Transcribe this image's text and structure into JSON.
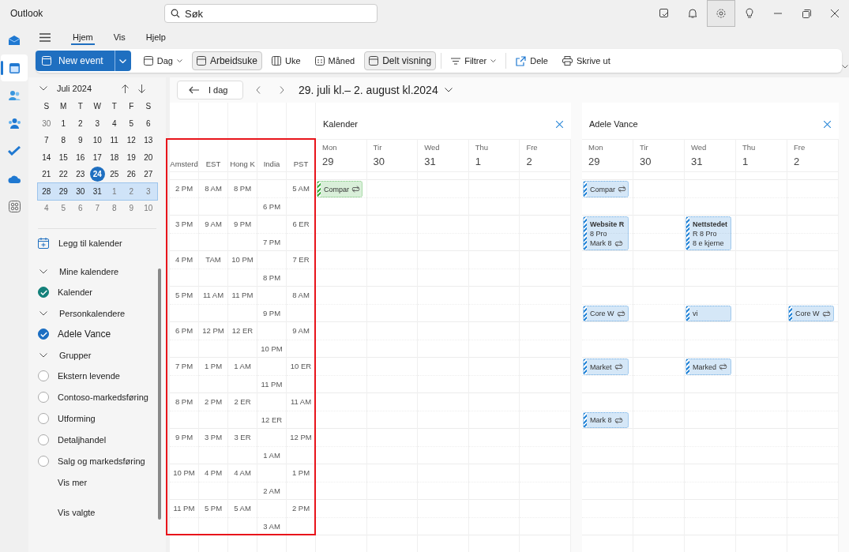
{
  "app_title": "Outlook",
  "search": {
    "placeholder": "Søk"
  },
  "settings": {
    "selected": true
  },
  "rail": [
    {
      "selected": false
    },
    {
      "selected": true
    },
    {
      "selected": false
    },
    {
      "selected": false
    },
    {
      "selected": false
    },
    {
      "selected": false
    },
    {
      "selected": false
    }
  ],
  "ribbon_tabs": [
    {
      "label": "Hjem",
      "selected": true
    },
    {
      "label": "Vis",
      "selected": false
    },
    {
      "label": "Hjelp",
      "selected": false
    }
  ],
  "new_event": "New event",
  "toolbar": [
    {
      "label": "Dag",
      "kind": "dropdown",
      "selected": false,
      "divider": false
    },
    {
      "label": "Arbeidsuke",
      "kind": "view",
      "selected": true,
      "divider": false
    },
    {
      "label": "Uke",
      "kind": "view",
      "selected": false,
      "divider": false
    },
    {
      "label": "Måned",
      "kind": "view",
      "selected": false,
      "divider": false
    },
    {
      "label": "Delt visning",
      "kind": "view",
      "selected": true,
      "divider": false
    },
    {
      "label": "Filtrer",
      "kind": "dropdown",
      "selected": false,
      "divider": true
    },
    {
      "label": "Dele",
      "kind": "action",
      "selected": false,
      "divider": true
    },
    {
      "label": "Skrive ut",
      "kind": "action",
      "selected": false,
      "divider": false
    }
  ],
  "mini_calendar": {
    "month": "Juli 2024",
    "weekdays": [
      "S",
      "M",
      "T",
      "W",
      "T",
      "F",
      "S"
    ],
    "weeks": [
      {
        "selected": false,
        "days": [
          {
            "label": "30",
            "other_month": true,
            "today": false
          },
          {
            "label": "1",
            "other_month": false,
            "today": false
          },
          {
            "label": "2",
            "other_month": false,
            "today": false
          },
          {
            "label": "3",
            "other_month": false,
            "today": false
          },
          {
            "label": "4",
            "other_month": false,
            "today": false
          },
          {
            "label": "5",
            "other_month": false,
            "today": false
          },
          {
            "label": "6",
            "other_month": false,
            "today": false
          }
        ]
      },
      {
        "selected": false,
        "days": [
          {
            "label": "7",
            "other_month": false,
            "today": false
          },
          {
            "label": "8",
            "other_month": false,
            "today": false
          },
          {
            "label": "9",
            "other_month": false,
            "today": false
          },
          {
            "label": "10",
            "other_month": false,
            "today": false
          },
          {
            "label": "11",
            "other_month": false,
            "today": false
          },
          {
            "label": "12",
            "other_month": false,
            "today": false
          },
          {
            "label": "13",
            "other_month": false,
            "today": false
          }
        ]
      },
      {
        "selected": false,
        "days": [
          {
            "label": "14",
            "other_month": false,
            "today": false
          },
          {
            "label": "15",
            "other_month": false,
            "today": false
          },
          {
            "label": "16",
            "other_month": false,
            "today": false
          },
          {
            "label": "17",
            "other_month": false,
            "today": false
          },
          {
            "label": "18",
            "other_month": false,
            "today": false
          },
          {
            "label": "19",
            "other_month": false,
            "today": false
          },
          {
            "label": "20",
            "other_month": false,
            "today": false
          }
        ]
      },
      {
        "selected": false,
        "days": [
          {
            "label": "21",
            "other_month": false,
            "today": false
          },
          {
            "label": "22",
            "other_month": false,
            "today": false
          },
          {
            "label": "23",
            "other_month": false,
            "today": false
          },
          {
            "label": "24",
            "other_month": false,
            "today": true
          },
          {
            "label": "25",
            "other_month": false,
            "today": false
          },
          {
            "label": "26",
            "other_month": false,
            "today": false
          },
          {
            "label": "27",
            "other_month": false,
            "today": false
          }
        ]
      },
      {
        "selected": true,
        "days": [
          {
            "label": "28",
            "other_month": false,
            "today": false
          },
          {
            "label": "29",
            "other_month": false,
            "today": false
          },
          {
            "label": "30",
            "other_month": false,
            "today": false
          },
          {
            "label": "31",
            "other_month": false,
            "today": false
          },
          {
            "label": "1",
            "other_month": true,
            "today": false
          },
          {
            "label": "2",
            "other_month": true,
            "today": false
          },
          {
            "label": "3",
            "other_month": true,
            "today": false
          }
        ]
      },
      {
        "selected": false,
        "days": [
          {
            "label": "4",
            "other_month": true,
            "today": false
          },
          {
            "label": "5",
            "other_month": true,
            "today": false
          },
          {
            "label": "6",
            "other_month": true,
            "today": false
          },
          {
            "label": "7",
            "other_month": true,
            "today": false
          },
          {
            "label": "8",
            "other_month": true,
            "today": false
          },
          {
            "label": "9",
            "other_month": true,
            "today": false
          },
          {
            "label": "10",
            "other_month": true,
            "today": false
          }
        ]
      }
    ]
  },
  "add_calendar": "Legg til kalender",
  "calendar_groups": [
    {
      "title": "Mine kalendere",
      "expanded": true,
      "items": [
        {
          "label": "Kalender",
          "checked": true,
          "color": "#13807a"
        }
      ]
    },
    {
      "title": "Personkalendere",
      "expanded": true,
      "items": [
        {
          "label": "Adele Vance",
          "checked": true,
          "color": "#1b6ec2"
        }
      ]
    },
    {
      "title": "Grupper",
      "expanded": true,
      "items": [
        {
          "label": "Ekstern levende",
          "checked": false
        },
        {
          "label": "Contoso-markedsføring",
          "checked": false
        },
        {
          "label": "Utforming",
          "checked": false
        },
        {
          "label": "Detaljhandel",
          "checked": false
        },
        {
          "label": "Salg og markedsføring",
          "checked": false
        }
      ]
    }
  ],
  "show_more": "Vis mer",
  "show_selected": "Vis valgte",
  "nav": {
    "today": "I dag",
    "range": "29. juli kl.– 2. august kl.2024"
  },
  "timezones": {
    "highlighted": true,
    "zones": [
      {
        "name": "Amsterd",
        "kind": "hour",
        "times": [
          "2 PM",
          "3 PM",
          "4 PM",
          "5 PM",
          "6 PM",
          "7 PM",
          "8 PM",
          "9 PM",
          "10 PM",
          "11 PM"
        ]
      },
      {
        "name": "EST",
        "kind": "hour",
        "times": [
          "8 AM",
          "9 AM",
          "TAM",
          "11 AM",
          "12 PM",
          "1 PM",
          "2 PM",
          "3 PM",
          "4 PM",
          "5 PM"
        ]
      },
      {
        "name": "Hong K",
        "kind": "hour",
        "times": [
          "8 PM",
          "9 PM",
          "10 PM",
          "11 PM",
          "12 ER",
          "1 AM",
          "2 ER",
          "3 ER",
          "4 AM",
          "5 AM"
        ]
      },
      {
        "name": "India",
        "kind": "half",
        "times": [
          "6 PM",
          "7 PM",
          "8 PM",
          "9 PM",
          "10 PM",
          "11 PM",
          "12 ER",
          "1 AM",
          "2 AM",
          "3 AM"
        ]
      },
      {
        "name": "PST",
        "kind": "hour",
        "times": [
          "5 AM",
          "6 ER",
          "7 ER",
          "8 AM",
          "9 AM",
          "10 ER",
          "11 AM",
          "12 PM",
          "1 PM",
          "2 PM"
        ]
      }
    ]
  },
  "panes": [
    {
      "title": "Kalender",
      "color": "#3fae3f",
      "days": [
        {
          "name": "Mon",
          "date": "29",
          "cells": [
            {
              "kind": "event",
              "lines": [
                "Compar"
              ],
              "recurring": true
            }
          ]
        },
        {
          "name": "Tir",
          "date": "30"
        },
        {
          "name": "Wed",
          "date": "31"
        },
        {
          "name": "Thu",
          "date": "1"
        },
        {
          "name": "Fre",
          "date": "2"
        }
      ]
    },
    {
      "title": "Adele Vance",
      "color": "#2b88d8",
      "days": [
        {
          "name": "Mon",
          "date": "29",
          "cells": [
            {
              "kind": "event",
              "lines": [
                "Compar"
              ],
              "recurring": true
            },
            {
              "kind": "gap"
            },
            {
              "kind": "long_event",
              "lines": [
                "Website R",
                "8 Pro",
                "Mark 8"
              ],
              "recurring": true
            },
            {
              "kind": "gap"
            },
            {
              "kind": "gap"
            },
            {
              "kind": "gap"
            },
            {
              "kind": "event",
              "lines": [
                "Core W"
              ],
              "recurring": true
            },
            {
              "kind": "gap"
            },
            {
              "kind": "gap"
            },
            {
              "kind": "event",
              "lines": [
                "Market"
              ],
              "recurring": true
            },
            {
              "kind": "gap"
            },
            {
              "kind": "gap"
            },
            {
              "kind": "event",
              "lines": [
                "Mark 8"
              ],
              "recurring": true
            }
          ]
        },
        {
          "name": "Tir",
          "date": "30"
        },
        {
          "name": "Wed",
          "date": "31",
          "cells": [
            {
              "kind": "gap"
            },
            {
              "kind": "gap"
            },
            {
              "kind": "long_event",
              "lines": [
                "Nettstedet",
                "R 8 Pro",
                "8 e kjerne"
              ],
              "recurring": false
            },
            {
              "kind": "gap"
            },
            {
              "kind": "gap"
            },
            {
              "kind": "gap"
            },
            {
              "kind": "event",
              "lines": [
                "vi"
              ],
              "recurring": false
            },
            {
              "kind": "gap"
            },
            {
              "kind": "gap"
            },
            {
              "kind": "event",
              "lines": [
                "Marked"
              ],
              "recurring": true
            }
          ]
        },
        {
          "name": "Thu",
          "date": "1"
        },
        {
          "name": "Fre",
          "date": "2",
          "cells": [
            {
              "kind": "gap"
            },
            {
              "kind": "gap"
            },
            {
              "kind": "gap"
            },
            {
              "kind": "gap"
            },
            {
              "kind": "gap"
            },
            {
              "kind": "gap"
            },
            {
              "kind": "gap"
            },
            {
              "kind": "event",
              "lines": [
                "Core W"
              ],
              "recurring": true
            }
          ]
        }
      ]
    }
  ]
}
